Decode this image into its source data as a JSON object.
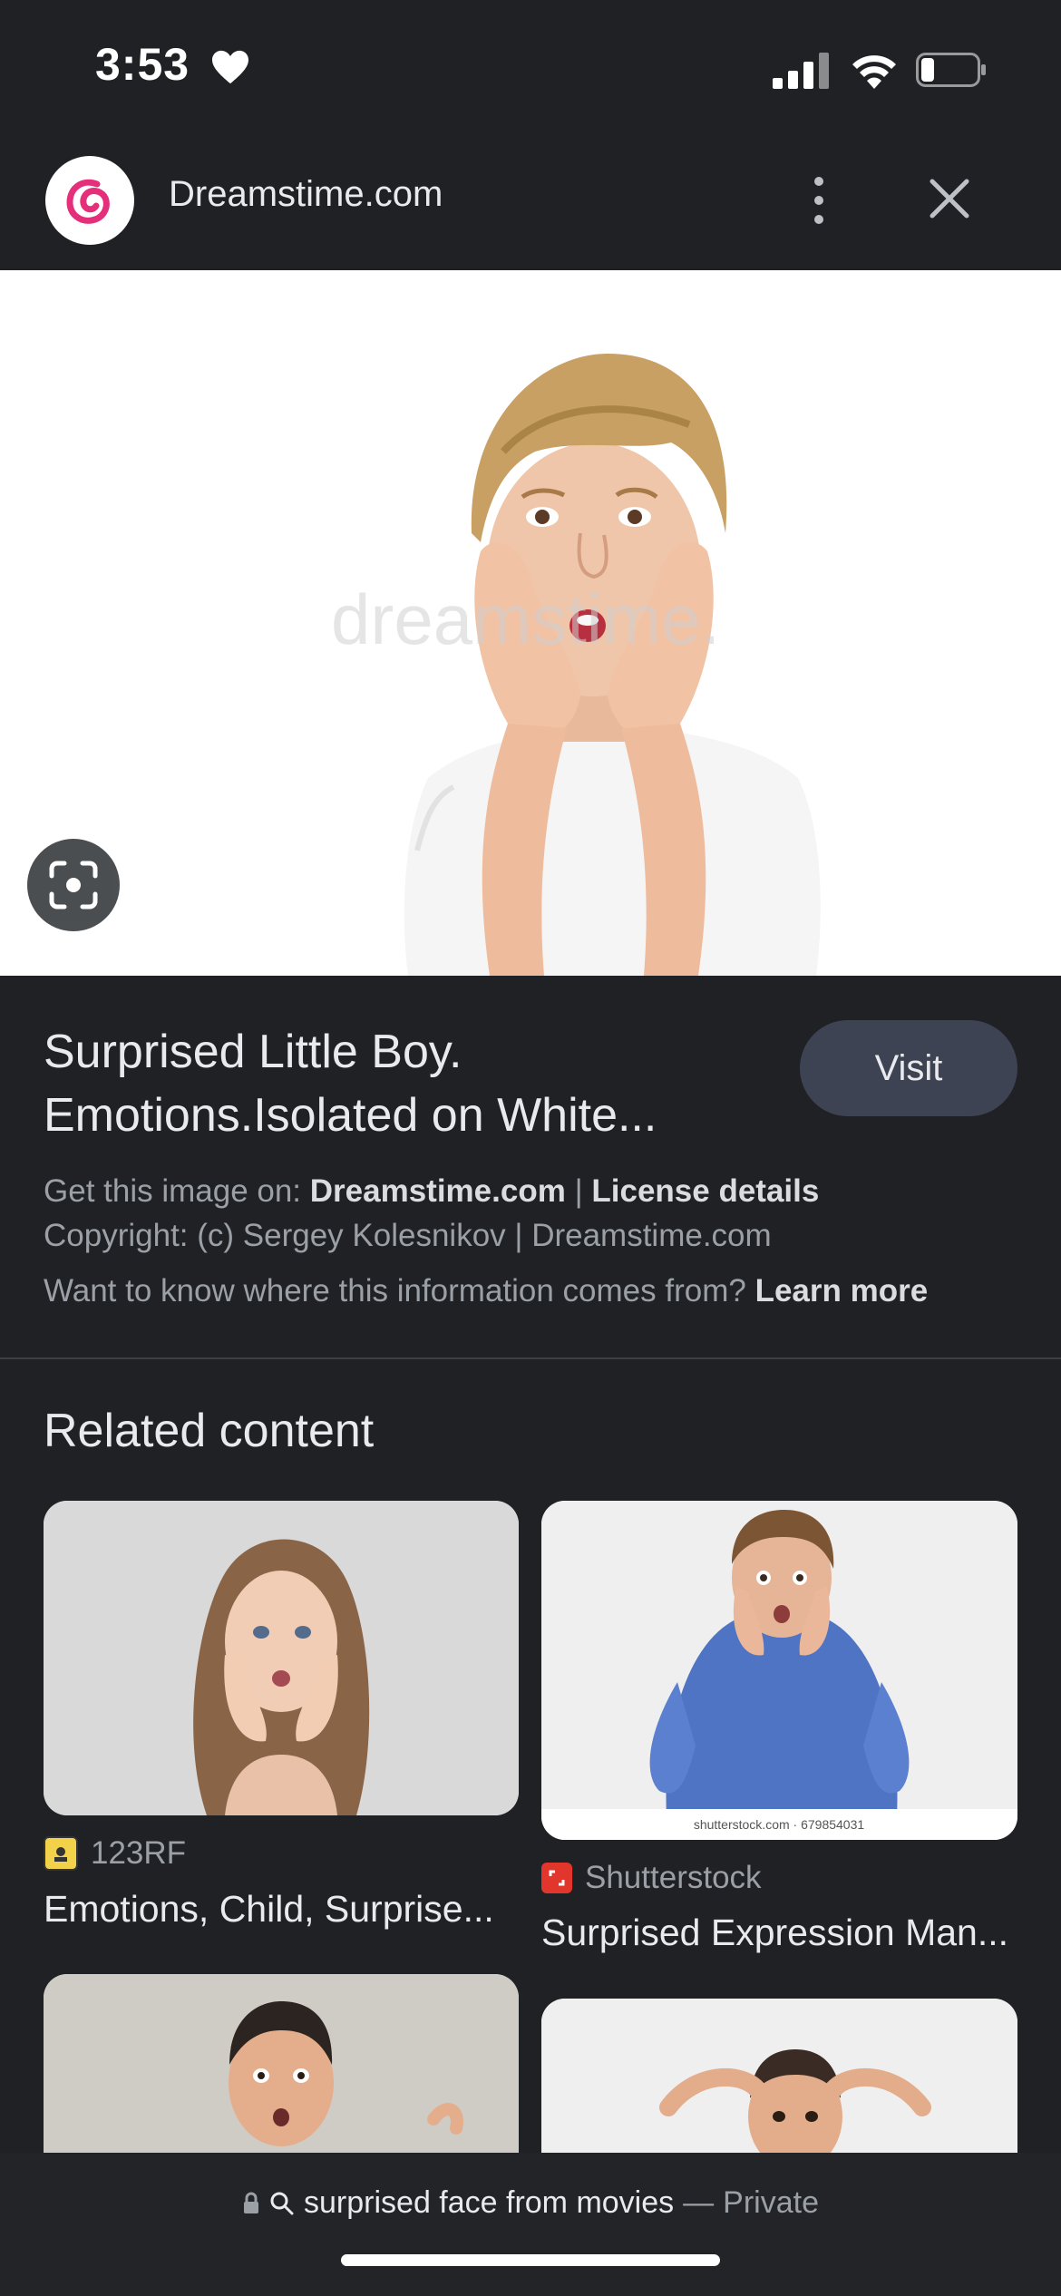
{
  "status_bar": {
    "time": "3:53"
  },
  "header": {
    "site_name": "Dreamstime.com"
  },
  "hero": {
    "watermark": "dreamstime."
  },
  "info": {
    "title": "Surprised Little Boy. Emotions.Isolated on White...",
    "visit_label": "Visit",
    "get_image_prefix": "Get this image on: ",
    "get_image_source": "Dreamstime.com",
    "license_label": "License details",
    "copyright": "Copyright: (c) Sergey Kolesnikov | Dreamstime.com",
    "learn_prefix": "Want to know where this information comes from? ",
    "learn_more": "Learn more"
  },
  "related": {
    "heading": "Related content",
    "cards": [
      {
        "source": "123RF",
        "caption": "Emotions, Child, Surprise..."
      },
      {
        "source": "Shutterstock",
        "caption": "Surprised Expression Man...",
        "image_id": "shutterstock.com · 679854031"
      },
      {
        "source": "",
        "caption": ""
      },
      {
        "source": "",
        "caption": ""
      }
    ]
  },
  "bottom_bar": {
    "query": "surprised face from movies",
    "separator": "—",
    "mode": "Private"
  },
  "colors": {
    "background": "#202124",
    "visit_button": "#3d4353",
    "dreamstime_logo": "#e4307a",
    "shutterstock_logo": "#e2352b"
  }
}
